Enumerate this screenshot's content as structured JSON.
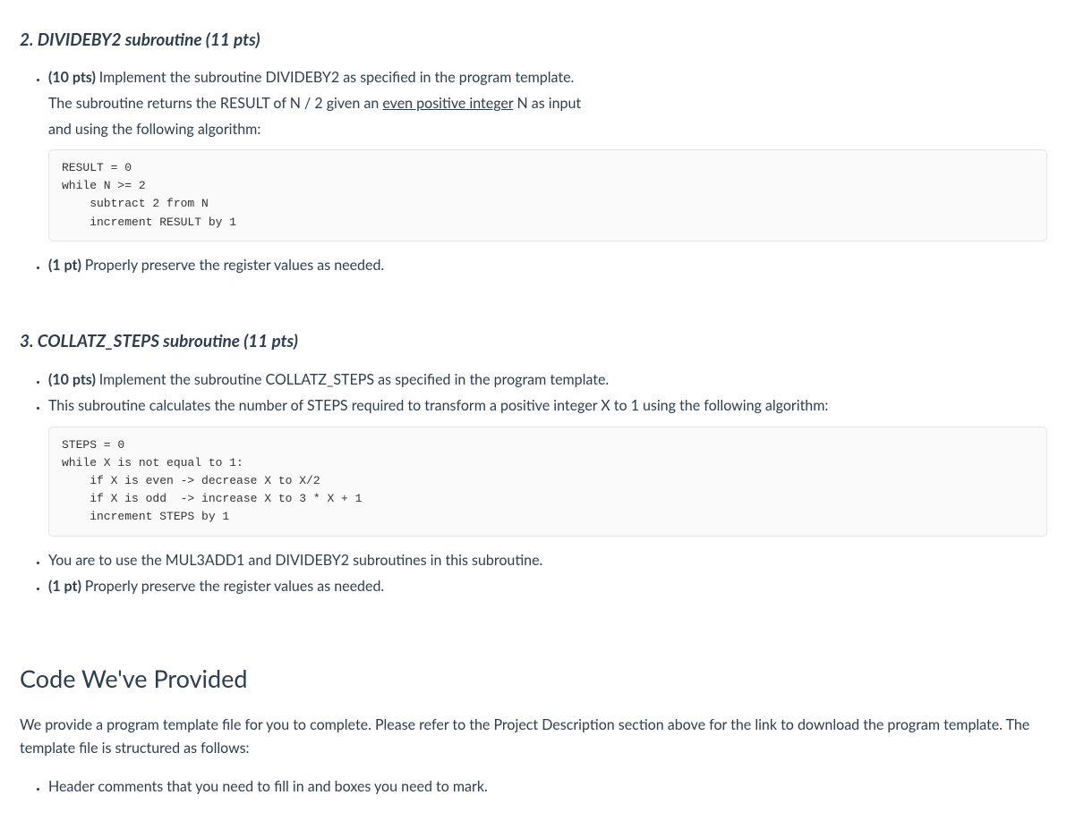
{
  "section2": {
    "heading": "2. DIVIDEBY2 subroutine (11 pts)",
    "item1_bold": "(10 pts) ",
    "item1_rest": "Implement the subroutine DIVIDEBY2 as specified in the program template.",
    "item1_line2a": "The subroutine returns the RESULT of N / 2 given an ",
    "item1_line2_underline": "even positive integer",
    "item1_line2b": " N as input",
    "item1_line3": "and using the following algorithm:",
    "code": "RESULT = 0\nwhile N >= 2\n    subtract 2 from N\n    increment RESULT by 1",
    "item2_bold": "(1 pt) ",
    "item2_rest": "Properly preserve the register values as needed."
  },
  "section3": {
    "heading": "3. COLLATZ_STEPS subroutine (11 pts)",
    "item1_bold": "(10 pts) ",
    "item1_rest": "Implement the subroutine COLLATZ_STEPS as specified in the program template.",
    "item2": "This subroutine calculates the number of STEPS required to transform a positive integer X to 1 using the following algorithm:",
    "code": "STEPS = 0\nwhile X is not equal to 1:\n    if X is even -> decrease X to X/2\n    if X is odd  -> increase X to 3 * X + 1\n    increment STEPS by 1",
    "item3": "You are to use the MUL3ADD1 and DIVIDEBY2 subroutines in this subroutine.",
    "item4_bold": "(1 pt) ",
    "item4_rest": "Properly preserve the register values as needed."
  },
  "provided": {
    "heading": "Code We've Provided",
    "para": "We provide a program template file for you to complete. Please refer to the Project Description section above for the link to download the program template. The template file is structured as follows:",
    "bullet1": "Header comments that you need to fill in and boxes you need to mark."
  }
}
